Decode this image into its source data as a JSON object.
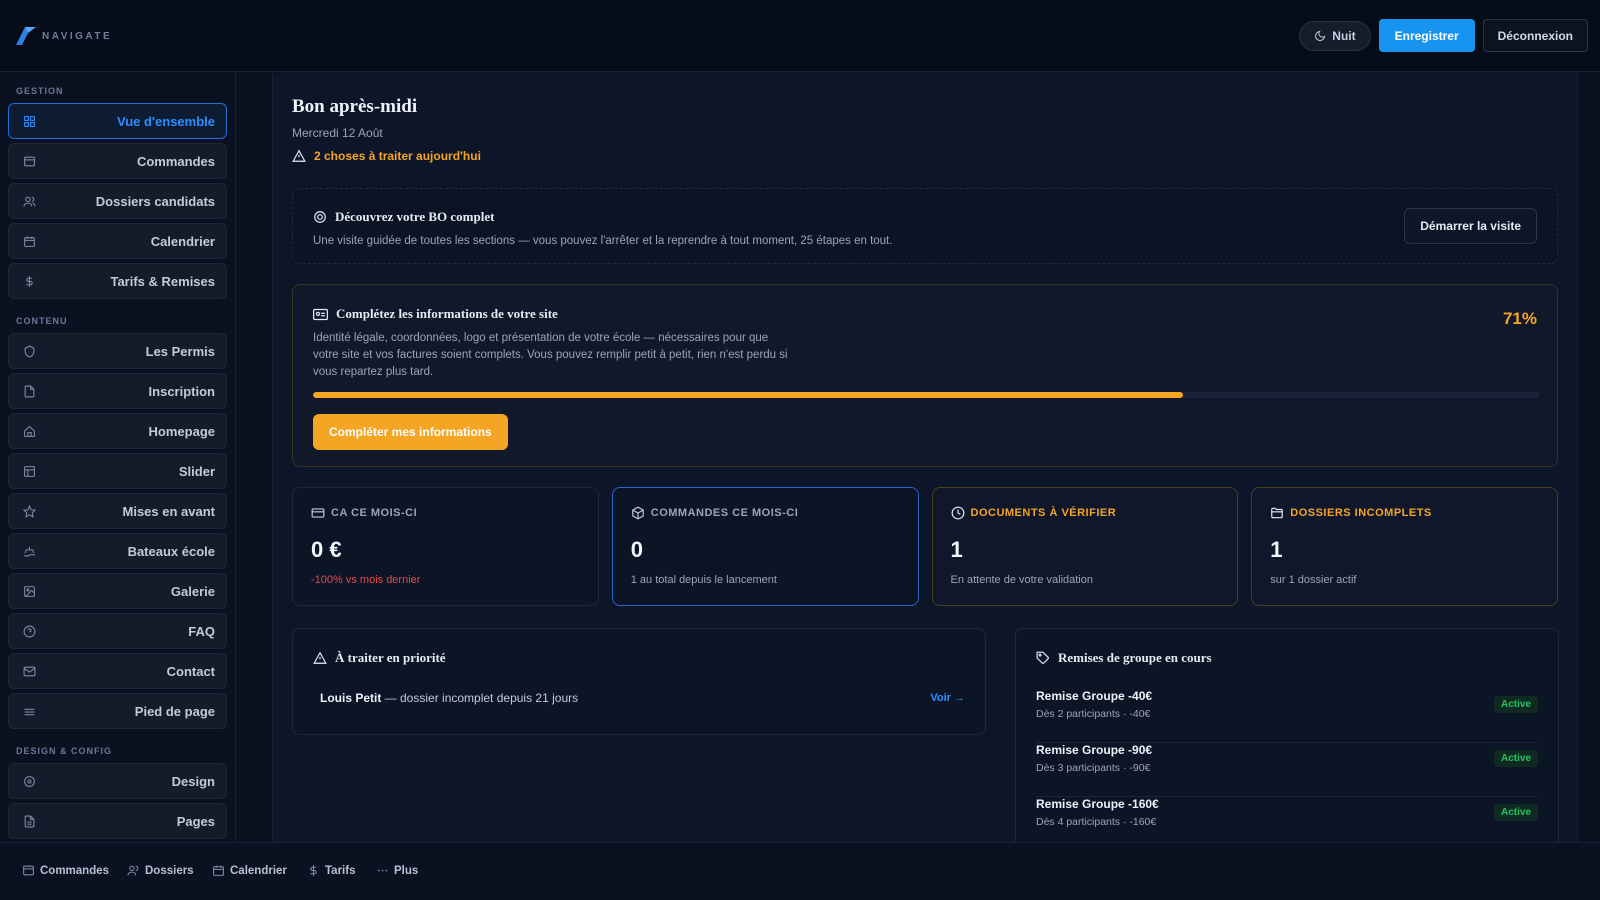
{
  "header": {
    "logo_text": "NAVIGATE",
    "night_label": "Nuit",
    "save_label": "Enregistrer",
    "logout_label": "Déconnexion"
  },
  "sidebar": {
    "sections": [
      {
        "label": "GESTION",
        "items": [
          {
            "label": "Vue d'ensemble",
            "icon": "grid-icon",
            "active": true
          },
          {
            "label": "Commandes",
            "icon": "archive-icon"
          },
          {
            "label": "Dossiers candidats",
            "icon": "users-icon"
          },
          {
            "label": "Calendrier",
            "icon": "calendar-icon"
          },
          {
            "label": "Tarifs & Remises",
            "icon": "dollar-icon"
          }
        ]
      },
      {
        "label": "CONTENU",
        "items": [
          {
            "label": "Les Permis",
            "icon": "shield-icon"
          },
          {
            "label": "Inscription",
            "icon": "file-icon"
          },
          {
            "label": "Homepage",
            "icon": "home-icon"
          },
          {
            "label": "Slider",
            "icon": "layout-icon"
          },
          {
            "label": "Mises en avant",
            "icon": "star-icon"
          },
          {
            "label": "Bateaux école",
            "icon": "boat-icon"
          },
          {
            "label": "Galerie",
            "icon": "image-icon"
          },
          {
            "label": "FAQ",
            "icon": "help-circle-icon"
          },
          {
            "label": "Contact",
            "icon": "mail-icon"
          },
          {
            "label": "Pied de page",
            "icon": "menu-icon"
          }
        ]
      },
      {
        "label": "DESIGN & CONFIG",
        "items": [
          {
            "label": "Design",
            "icon": "target-icon"
          },
          {
            "label": "Pages",
            "icon": "file-text-icon"
          }
        ]
      }
    ]
  },
  "main": {
    "greeting": "Bon après-midi",
    "date": "Mercredi 12 Août",
    "alert_text": "2 choses à traiter aujourd'hui",
    "tour": {
      "title": "Découvrez votre BO complet",
      "description": "Une visite guidée de toutes les sections — vous pouvez l'arrêter et la reprendre à tout moment, 25 étapes en tout.",
      "button": "Démarrer la visite"
    },
    "completion": {
      "title": "Complétez les informations de votre site",
      "description": "Identité légale, coordonnées, logo et présentation de votre école — nécessaires pour que votre site et vos factures soient complets. Vous pouvez remplir petit à petit, rien n'est perdu si vous repartez plus tard.",
      "percent_label": "71%",
      "progress": 0.71,
      "button": "Compléter mes informations"
    },
    "stats": [
      {
        "title": "CA CE MOIS-CI",
        "value": "0 €",
        "sub": "-100% vs mois dernier",
        "icon": "credit-card-icon"
      },
      {
        "title": "COMMANDES CE MOIS-CI",
        "value": "0",
        "sub": "1 au total depuis le lancement",
        "icon": "package-icon"
      },
      {
        "title": "DOCUMENTS À VÉRIFIER",
        "value": "1",
        "sub": "En attente de votre validation",
        "icon": "clock-icon"
      },
      {
        "title": "DOSSIERS INCOMPLETS",
        "value": "1",
        "sub": "sur 1 dossier actif",
        "icon": "folder-icon"
      }
    ],
    "priority": {
      "title": "À traiter en priorité",
      "row_name": "Louis Petit",
      "row_text": " — dossier incomplet depuis 21 jours",
      "link": "Voir →"
    },
    "remises": {
      "title": "Remises de groupe en cours",
      "items": [
        {
          "name": "Remise Groupe -40€",
          "sub": "Dès 2 participants · -40€",
          "status": "Active"
        },
        {
          "name": "Remise Groupe -90€",
          "sub": "Dès 3 participants · -90€",
          "status": "Active"
        },
        {
          "name": "Remise Groupe -160€",
          "sub": "Dès 4 participants · -160€",
          "status": "Active"
        }
      ]
    }
  },
  "bottombar": {
    "items": [
      {
        "label": "Commandes",
        "icon": "archive-icon"
      },
      {
        "label": "Dossiers",
        "icon": "users-icon"
      },
      {
        "label": "Calendrier",
        "icon": "calendar-icon"
      },
      {
        "label": "Tarifs",
        "icon": "dollar-icon"
      },
      {
        "label": "Plus",
        "icon": "more-icon"
      }
    ]
  },
  "colors": {
    "accent_blue": "#1794f0",
    "accent_orange": "#f5a524",
    "success_green": "#22c55e",
    "danger_red": "#e5484d",
    "background": "#0a1120"
  }
}
